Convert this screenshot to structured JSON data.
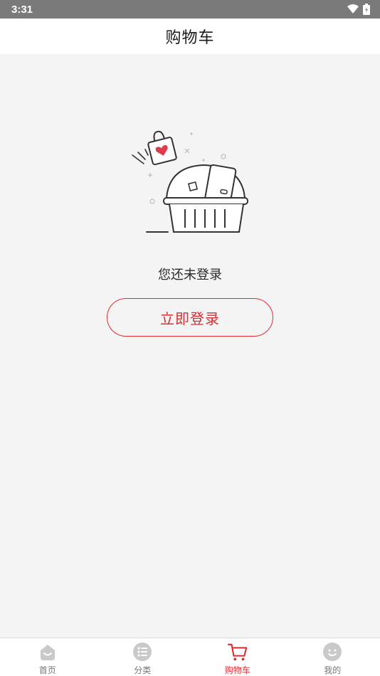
{
  "status_bar": {
    "time": "3:31"
  },
  "header": {
    "title": "购物车"
  },
  "empty_state": {
    "message": "您还未登录",
    "login_button_label": "立即登录",
    "illustration": "empty-shopping-basket"
  },
  "tabbar": {
    "active_index": 2,
    "accent_color": "#e02a2f",
    "tabs": [
      {
        "label": "首页",
        "icon": "home-icon"
      },
      {
        "label": "分类",
        "icon": "category-icon"
      },
      {
        "label": "购物车",
        "icon": "cart-icon"
      },
      {
        "label": "我的",
        "icon": "profile-icon"
      }
    ]
  }
}
